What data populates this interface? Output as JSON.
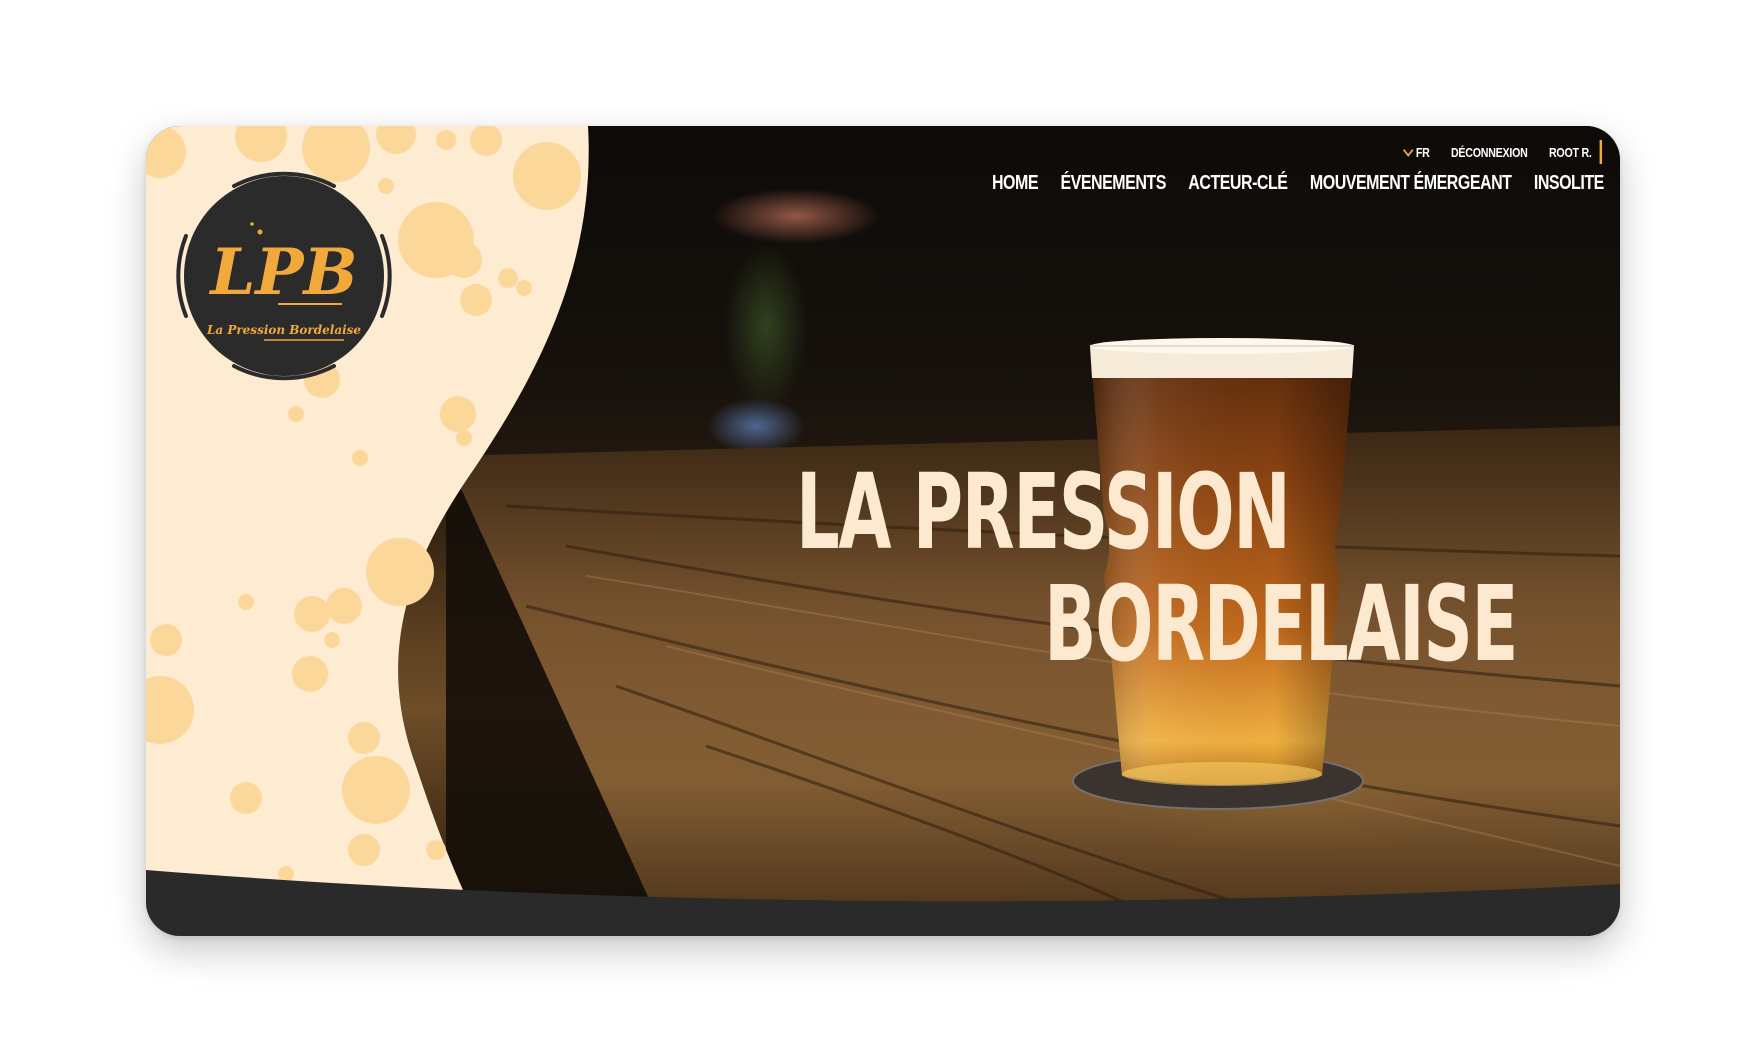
{
  "brand": {
    "logo_initials": "LPB",
    "logo_tagline": "La Pression Bordelaise"
  },
  "top_bar": {
    "language": "FR",
    "logout": "DÉCONNEXION",
    "user": "ROOT R."
  },
  "main_nav": [
    {
      "label": "HOME"
    },
    {
      "label": "ÉVENEMENTS"
    },
    {
      "label": "ACTEUR-CLÉ"
    },
    {
      "label": "MOUVEMENT ÉMERGEANT"
    },
    {
      "label": "INSOLITE"
    }
  ],
  "hero": {
    "title_line1": "LA PRESSION",
    "title_line2": "BORDELAISE"
  },
  "colors": {
    "accent": "#f2a93b",
    "cream": "#fdecd2",
    "bubble": "#fbd79a",
    "dark": "#2a2a2a",
    "title": "#fce9cf"
  },
  "icons": {
    "language_dropdown": "chevron-down-icon"
  }
}
